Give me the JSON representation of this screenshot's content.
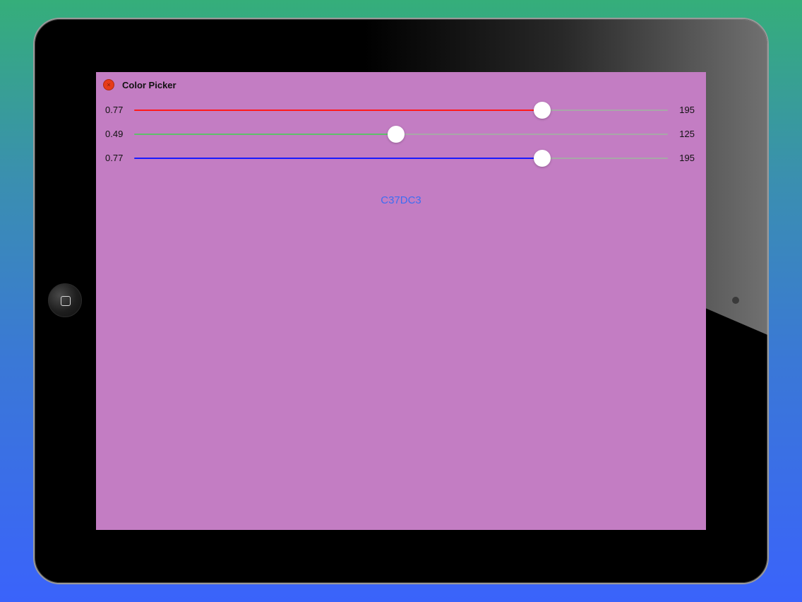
{
  "window": {
    "title": "Color Picker",
    "close_icon_glyph": "×"
  },
  "colors": {
    "background": "#c37dc3",
    "hex_text": "#3d6df2"
  },
  "sliders": [
    {
      "channel": "red",
      "fraction_label": "0.77",
      "value_label": "195",
      "value": 195,
      "max": 255,
      "color": "#ff1a1a"
    },
    {
      "channel": "green",
      "fraction_label": "0.49",
      "value_label": "125",
      "value": 125,
      "max": 255,
      "color": "#5fbf6a"
    },
    {
      "channel": "blue",
      "fraction_label": "0.77",
      "value_label": "195",
      "value": 195,
      "max": 255,
      "color": "#1a1aff"
    }
  ],
  "hex": "C37DC3"
}
